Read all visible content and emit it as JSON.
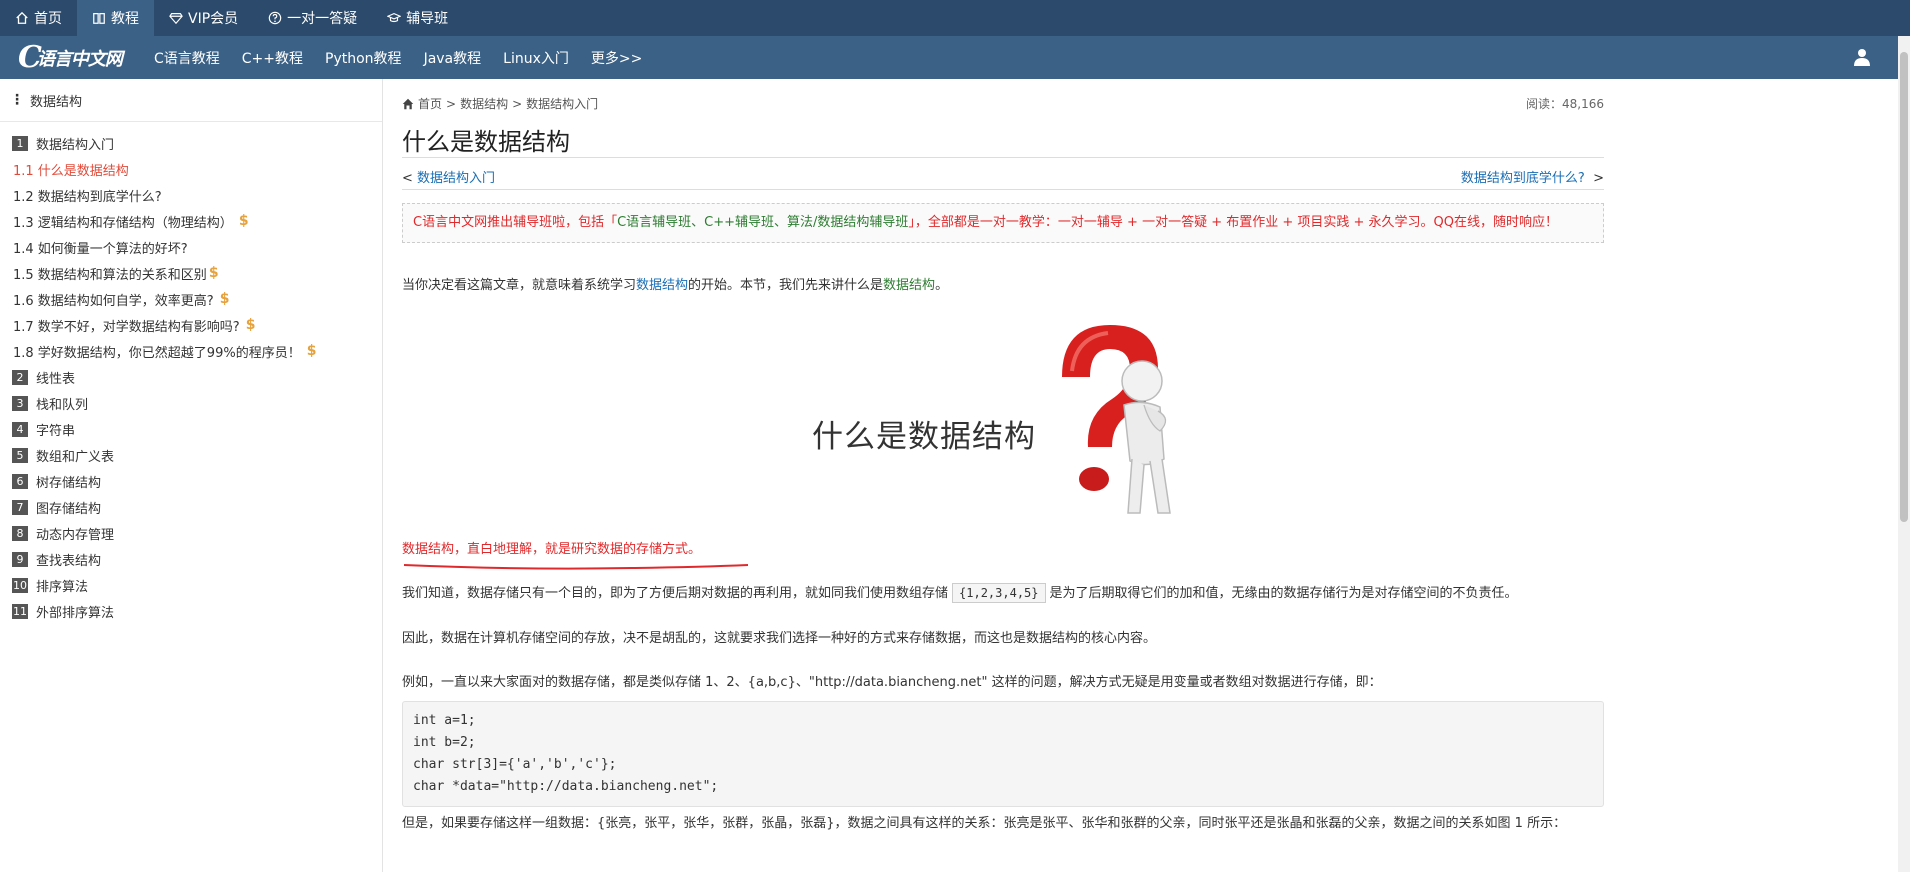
{
  "topbar": {
    "items": [
      {
        "label": "首页",
        "icon": "home-icon"
      },
      {
        "label": "教程",
        "icon": "book-icon"
      },
      {
        "label": "VIP会员",
        "icon": "diamond-icon"
      },
      {
        "label": "一对一答疑",
        "icon": "question-circle-icon"
      },
      {
        "label": "辅导班",
        "icon": "graduation-cap-icon"
      }
    ]
  },
  "mainnav": {
    "logo_text": "语言中文网",
    "logo_c": "C",
    "items": [
      "C语言教程",
      "C++教程",
      "Python教程",
      "Java教程",
      "Linux入门",
      "更多>>"
    ]
  },
  "sidebar": {
    "title": "数据结构",
    "chapters": [
      {
        "num": "1",
        "label": "数据结构入门"
      },
      {
        "num": "2",
        "label": "线性表"
      },
      {
        "num": "3",
        "label": "栈和队列"
      },
      {
        "num": "4",
        "label": "字符串"
      },
      {
        "num": "5",
        "label": "数组和广义表"
      },
      {
        "num": "6",
        "label": "树存储结构"
      },
      {
        "num": "7",
        "label": "图存储结构"
      },
      {
        "num": "8",
        "label": "动态内存管理"
      },
      {
        "num": "9",
        "label": "查找表结构"
      },
      {
        "num": "10",
        "label": "排序算法"
      },
      {
        "num": "11",
        "label": "外部排序算法"
      }
    ],
    "subitems": [
      {
        "label": "1.1 什么是数据结构"
      },
      {
        "label": "1.2 数据结构到底学什么?"
      },
      {
        "label": "1.3 逻辑结构和存储结构（物理结构）"
      },
      {
        "label": "1.4 如何衡量一个算法的好坏?"
      },
      {
        "label": "1.5 数据结构和算法的关系和区别"
      },
      {
        "label": "1.6 数据结构如何自学，效率更高?"
      },
      {
        "label": "1.7 数学不好，对学数据结构有影响吗?"
      },
      {
        "label": "1.8 学好数据结构，你已然超越了99%的程序员！"
      }
    ],
    "dollar": "$"
  },
  "article": {
    "breadcrumb": {
      "home": "首页",
      "sep": ">",
      "level1": "数据结构",
      "level2": "数据结构入门"
    },
    "read_count": "阅读：48,166",
    "title": "什么是数据结构",
    "prev_arrow": "<",
    "prev_label": "数据结构入门",
    "next_label": "数据结构到底学什么?",
    "next_arrow": ">",
    "notice": {
      "part1": "C语言中文网推出辅导班啦，包括「",
      "green": "C语言辅导班、C++辅导班、算法/数据结构辅导班",
      "part2": "」，全部都是一对一教学：一对一辅导 + 一对一答疑 + 布置作业 + 项目实践 + 永久学习。QQ在线，随时响应！"
    },
    "intro": {
      "a": "当你决定看这篇文章，就意味着系统学习",
      "link": "数据结构",
      "b": "的开始。本节，我们先来讲什么是",
      "link2": "数据结构",
      "c": "。"
    },
    "hero_text": "什么是数据结构",
    "highlight": "数据结构，直白地理解，就是研究数据的存储方式。",
    "p1": {
      "a": "我们知道，数据存储只有一个目的，即为了方便后期对数据的再利用，就如同我们使用数组存储",
      "code": "{1,2,3,4,5}",
      "b": "是为了后期取得它们的加和值，无缘由的数据存储行为是对存储空间的不负责任。"
    },
    "p2": "因此，数据在计算机存储空间的存放，决不是胡乱的，这就要求我们选择一种好的方式来存储数据，而这也是数据结构的核心内容。",
    "p3": "例如，一直以来大家面对的数据存储，都是类似存储 1、2、{a,b,c}、\"http://data.biancheng.net\" 这样的问题，解决方式无疑是用变量或者数组对数据进行存储，即：",
    "code_lines": [
      "int a=1;",
      "int b=2;",
      "char str[3]={'a','b','c'};",
      "char *data=\"http://data.biancheng.net\";"
    ],
    "p4": "但是，如果要存储这样一组数据：{张亮，张平，张华，张群，张晶，张磊}，数据之间具有这样的关系：张亮是张平、张华和张群的父亲，同时张平还是张晶和张磊的父亲，数据之间的关系如图 1 所示："
  },
  "colors": {
    "topbar": "#2c4a6b",
    "mainnav": "#3b6186",
    "link": "#1a6eb4",
    "current": "#e04b3a",
    "notice_red": "#e0292b",
    "dollar": "#e6a23c"
  }
}
